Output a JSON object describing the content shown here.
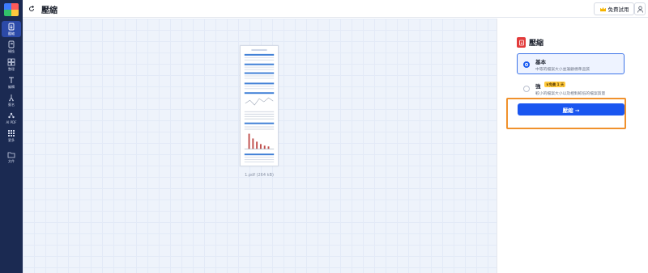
{
  "rail": {
    "items": [
      {
        "label": "壓縮",
        "icon": "compress-icon",
        "active": true
      },
      {
        "label": "轉換",
        "icon": "convert-icon"
      },
      {
        "label": "整理",
        "icon": "organize-icon"
      },
      {
        "label": "編輯",
        "icon": "edit-text-icon"
      },
      {
        "label": "簽名",
        "icon": "sign-icon"
      },
      {
        "label": "AI PDF",
        "icon": "ai-icon"
      },
      {
        "label": "更多",
        "icon": "more-grid-icon"
      },
      {
        "label": "文件",
        "icon": "folder-icon"
      }
    ]
  },
  "topbar": {
    "title": "壓縮",
    "trial_label": "免費試用"
  },
  "canvas": {
    "file_label": "1.pdf (264 kB)"
  },
  "panel": {
    "title": "壓縮",
    "options": [
      {
        "title": "基本",
        "desc": "中等的檔案大小並兼顧標準品質",
        "selected": true
      },
      {
        "title": "強",
        "badge": "♛免費 1 天",
        "desc": "較小的檔案大小以及相對較低的檔案質量",
        "selected": false
      }
    ],
    "compress_button": "壓縮 →"
  },
  "colors": {
    "rail_bg": "#1b2a52",
    "accent": "#1a56f0",
    "highlight": "#f0912c",
    "badge": "#ffc93c"
  }
}
